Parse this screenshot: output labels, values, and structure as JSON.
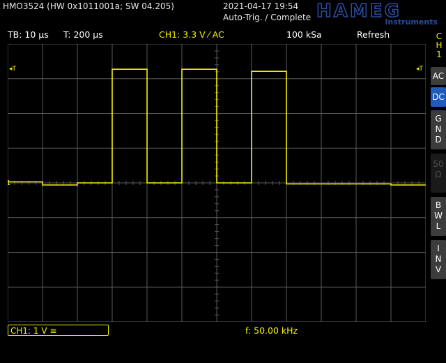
{
  "header": {
    "device": "HMO3524 (HW 0x1011001a; SW 04.205)",
    "datetime": "2021-04-17 19:54",
    "status": "Auto-Trig. / Complete",
    "brand": "HAMEG",
    "brand_sub": "Instruments"
  },
  "settings": {
    "timebase": "TB: 10 µs",
    "trigger_time": "T: 200 µs",
    "channel": "CH1: 3.3 V ⁄ AC",
    "sample_rate": "100 kSa",
    "mode": "Refresh"
  },
  "side_menu": {
    "channel_label": [
      "C",
      "H",
      "1"
    ],
    "buttons": [
      {
        "label": "AC"
      },
      {
        "label": "DC"
      },
      {
        "label": "G N D"
      },
      {
        "label": "50 Ω"
      },
      {
        "label": "B W L"
      },
      {
        "label": "I N V"
      }
    ]
  },
  "bottom": {
    "channel_info": "CH1: 1 V ≅",
    "frequency": "f: 50.00 kHz"
  },
  "markers": {
    "trigger_left": "◂T",
    "trigger_right": "◂T",
    "ch1_ref": "1"
  },
  "colors": {
    "trace": "#f4f000",
    "grid": "#5a5a5a",
    "active_button": "#1f5bbd"
  },
  "chart_data": {
    "type": "line",
    "title": "",
    "xlabel": "",
    "ylabel": "",
    "x_unit": "µs",
    "y_unit": "V",
    "xlim": [
      0,
      120
    ],
    "ylim": [
      -13.2,
      13.2
    ],
    "grid": true,
    "series": [
      {
        "x": [
          0,
          10,
          10,
          20,
          20,
          30,
          30,
          40,
          40,
          50,
          50,
          60,
          60,
          70,
          70,
          80,
          80,
          90,
          90,
          100,
          100,
          110,
          110,
          120
        ],
        "values": [
          0.1,
          0.1,
          -0.2,
          -0.2,
          0.0,
          0.0,
          10.8,
          10.8,
          0.0,
          0.0,
          10.8,
          10.8,
          0.0,
          0.0,
          10.6,
          10.6,
          -0.1,
          -0.1,
          -0.1,
          -0.1,
          -0.1,
          -0.1,
          -0.2,
          -0.2
        ]
      }
    ]
  }
}
